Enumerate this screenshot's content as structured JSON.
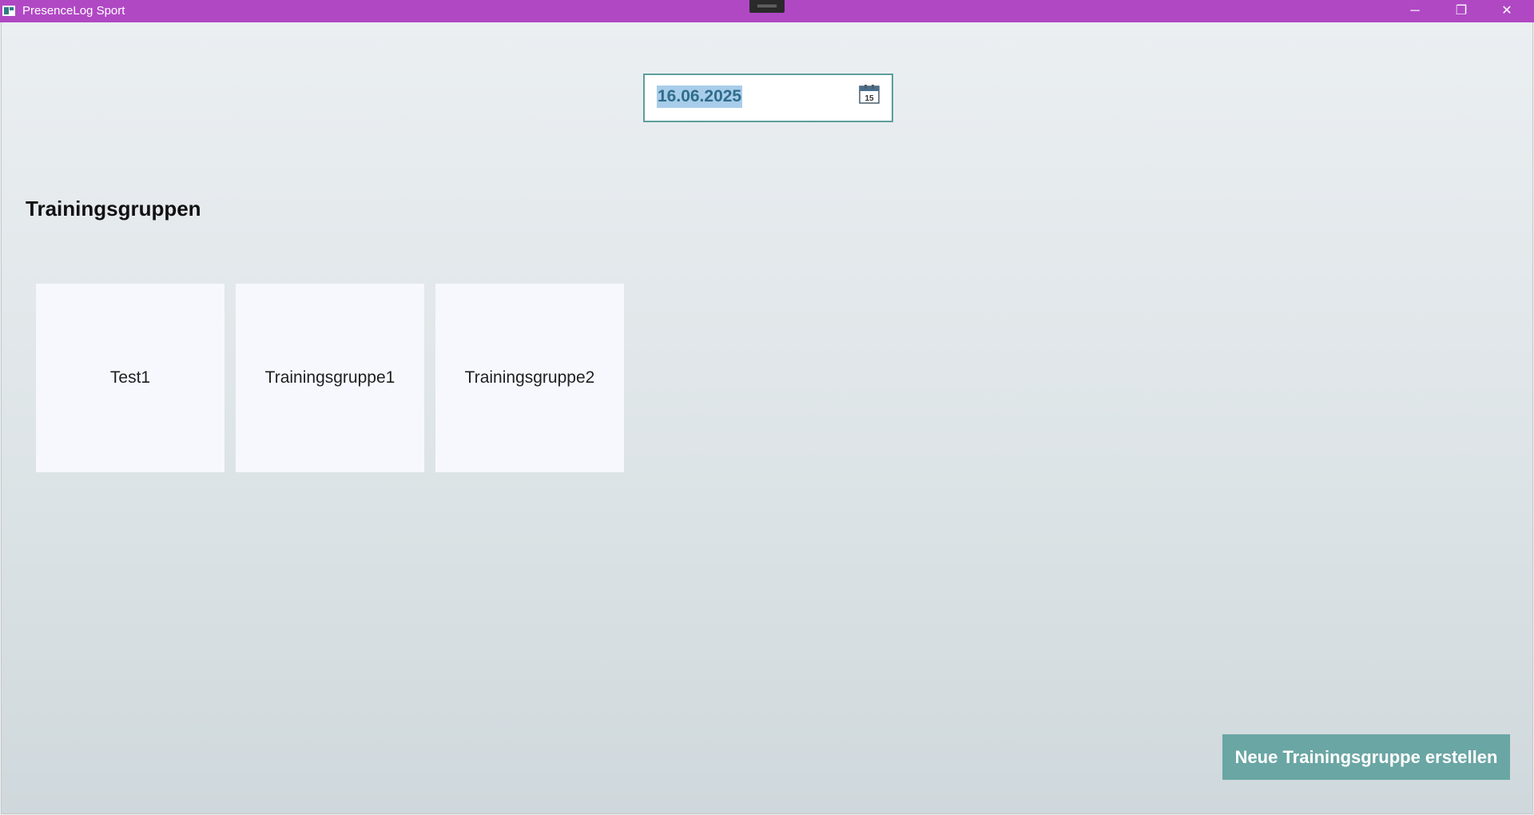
{
  "window": {
    "title": "PresenceLog Sport",
    "controls": {
      "minimize": "─",
      "maximize": "❐",
      "close": "✕"
    }
  },
  "date_picker": {
    "value": "16.06.2025",
    "icon": "calendar-icon",
    "icon_day": "15"
  },
  "section": {
    "title": "Trainingsgruppen"
  },
  "groups": [
    {
      "label": "Test1"
    },
    {
      "label": "Trainingsgruppe1"
    },
    {
      "label": "Trainingsgruppe2"
    }
  ],
  "actions": {
    "create_group_label": "Neue Trainingsgruppe erstellen"
  },
  "colors": {
    "titlebar": "#b048c4",
    "accent": "#6aa6a4",
    "date_border": "#5d9e9c",
    "card_background": "#f6f8fd"
  }
}
